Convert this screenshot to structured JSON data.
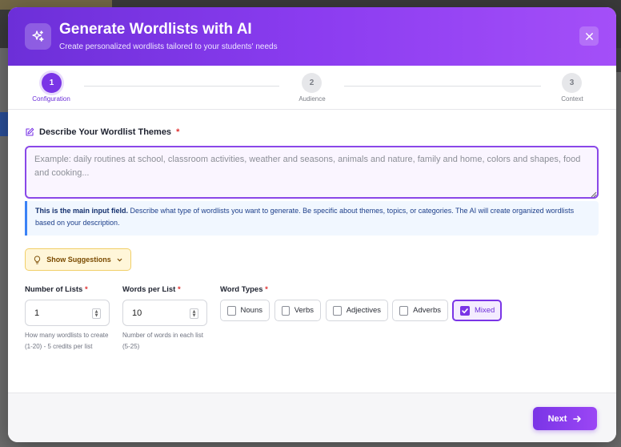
{
  "modal": {
    "title": "Generate Wordlists with AI",
    "subtitle": "Create personalized wordlists tailored to your students' needs",
    "header_icon": "sparkles-icon",
    "close_icon": "close-icon"
  },
  "stepper": {
    "steps": [
      {
        "number": "1",
        "label": "Configuration",
        "state": "active"
      },
      {
        "number": "2",
        "label": "Audience",
        "state": "inactive"
      },
      {
        "number": "3",
        "label": "Context",
        "state": "inactive"
      }
    ]
  },
  "themes": {
    "label": "Describe Your Wordlist Themes",
    "required_mark": "*",
    "icon": "edit-icon",
    "placeholder": "Example: daily routines at school, classroom activities, weather and seasons, animals and nature, family and home, colors and shapes, food and cooking...",
    "value": ""
  },
  "info": {
    "bold": "This is the main input field.",
    "text": " Describe what type of wordlists you want to generate. Be specific about themes, topics, or categories. The AI will create organized wordlists based on your description."
  },
  "suggestions": {
    "label": "Show Suggestions",
    "icon": "lightbulb-icon",
    "chevron": "chevron-down-icon"
  },
  "num_lists": {
    "label": "Number of Lists",
    "required_mark": "*",
    "value": "1",
    "help": "How many wordlists to create (1-20) - 5 credits per list"
  },
  "words_per_list": {
    "label": "Words per List",
    "required_mark": "*",
    "value": "10",
    "help": "Number of words in each list (5-25)"
  },
  "word_types": {
    "label": "Word Types",
    "required_mark": "*",
    "options": [
      {
        "label": "Nouns",
        "checked": false
      },
      {
        "label": "Verbs",
        "checked": false
      },
      {
        "label": "Adjectives",
        "checked": false
      },
      {
        "label": "Adverbs",
        "checked": false
      },
      {
        "label": "Mixed",
        "checked": true
      }
    ]
  },
  "footer": {
    "next_label": "Next",
    "next_icon": "arrow-right-icon"
  },
  "colors": {
    "accent": "#7a35e6",
    "header_gradient_start": "#6c2fd8",
    "header_gradient_end": "#a44ff8",
    "info_border": "#3b82f6",
    "suggestion_bg": "#fff6d9",
    "required": "#e03131"
  }
}
